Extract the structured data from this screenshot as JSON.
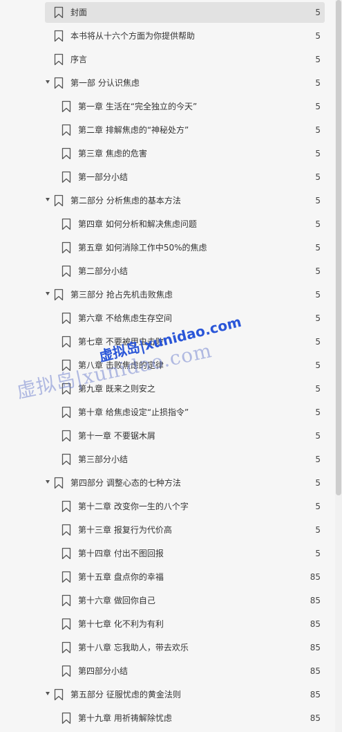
{
  "toc": {
    "items": [
      {
        "title": "封面",
        "page": "5",
        "level": 0,
        "expandable": false,
        "selected": true
      },
      {
        "title": "本书将从十六个方面为你提供帮助",
        "page": "5",
        "level": 0,
        "expandable": false
      },
      {
        "title": "序言",
        "page": "5",
        "level": 0,
        "expandable": false
      },
      {
        "title": "第一部 分认识焦虑",
        "page": "5",
        "level": 0,
        "expandable": true
      },
      {
        "title": "第一章 生活在“完全独立的今天”",
        "page": "5",
        "level": 1
      },
      {
        "title": "第二章 排解焦虑的“神秘处方”",
        "page": "5",
        "level": 1
      },
      {
        "title": "第三章 焦虑的危害",
        "page": "5",
        "level": 1
      },
      {
        "title": "第一部分小结",
        "page": "5",
        "level": 1
      },
      {
        "title": "第二部分 分析焦虑的基本方法",
        "page": "5",
        "level": 0,
        "expandable": true
      },
      {
        "title": "第四章 如何分析和解决焦虑问题",
        "page": "5",
        "level": 1
      },
      {
        "title": "第五章 如何消除工作中50%的焦虑",
        "page": "5",
        "level": 1
      },
      {
        "title": "第二部分小结",
        "page": "5",
        "level": 1
      },
      {
        "title": "第三部分 抢占先机击败焦虑",
        "page": "5",
        "level": 0,
        "expandable": true
      },
      {
        "title": "第六章 不给焦虑生存空间",
        "page": "5",
        "level": 1
      },
      {
        "title": "第七章 不要被甲虫击败",
        "page": "5",
        "level": 1
      },
      {
        "title": "第八章 击败焦虑的定律",
        "page": "5",
        "level": 1
      },
      {
        "title": "第九章 既来之则安之",
        "page": "5",
        "level": 1
      },
      {
        "title": "第十章 给焦虑设定“止损指令”",
        "page": "5",
        "level": 1
      },
      {
        "title": "第十一章 不要锯木屑",
        "page": "5",
        "level": 1
      },
      {
        "title": "第三部分小结",
        "page": "5",
        "level": 1
      },
      {
        "title": "第四部分 调整心态的七种方法",
        "page": "5",
        "level": 0,
        "expandable": true
      },
      {
        "title": "第十二章 改变你一生的八个字",
        "page": "5",
        "level": 1
      },
      {
        "title": "第十三章 报复行为代价高",
        "page": "5",
        "level": 1
      },
      {
        "title": "第十四章 付出不图回报",
        "page": "5",
        "level": 1
      },
      {
        "title": "第十五章 盘点你的幸福",
        "page": "85",
        "level": 1
      },
      {
        "title": "第十六章 做回你自己",
        "page": "85",
        "level": 1
      },
      {
        "title": "第十七章 化不利为有利",
        "page": "85",
        "level": 1
      },
      {
        "title": "第十八章 忘我助人，带去欢乐",
        "page": "85",
        "level": 1
      },
      {
        "title": "第四部分小结",
        "page": "85",
        "level": 1
      },
      {
        "title": "第五部分 征服忧虑的黄金法则",
        "page": "85",
        "level": 0,
        "expandable": true
      },
      {
        "title": "第十九章 用祈祷解除忧虑",
        "page": "85",
        "level": 1
      }
    ]
  },
  "watermark": {
    "text_serif": "虚拟岛|xunidao.com",
    "text_bold": "虚拟岛|xunidao.com"
  },
  "colors": {
    "background": "#f6f6f6",
    "selected_row": "#e2e2e2",
    "text": "#333333",
    "watermark": "#2a56d8"
  }
}
